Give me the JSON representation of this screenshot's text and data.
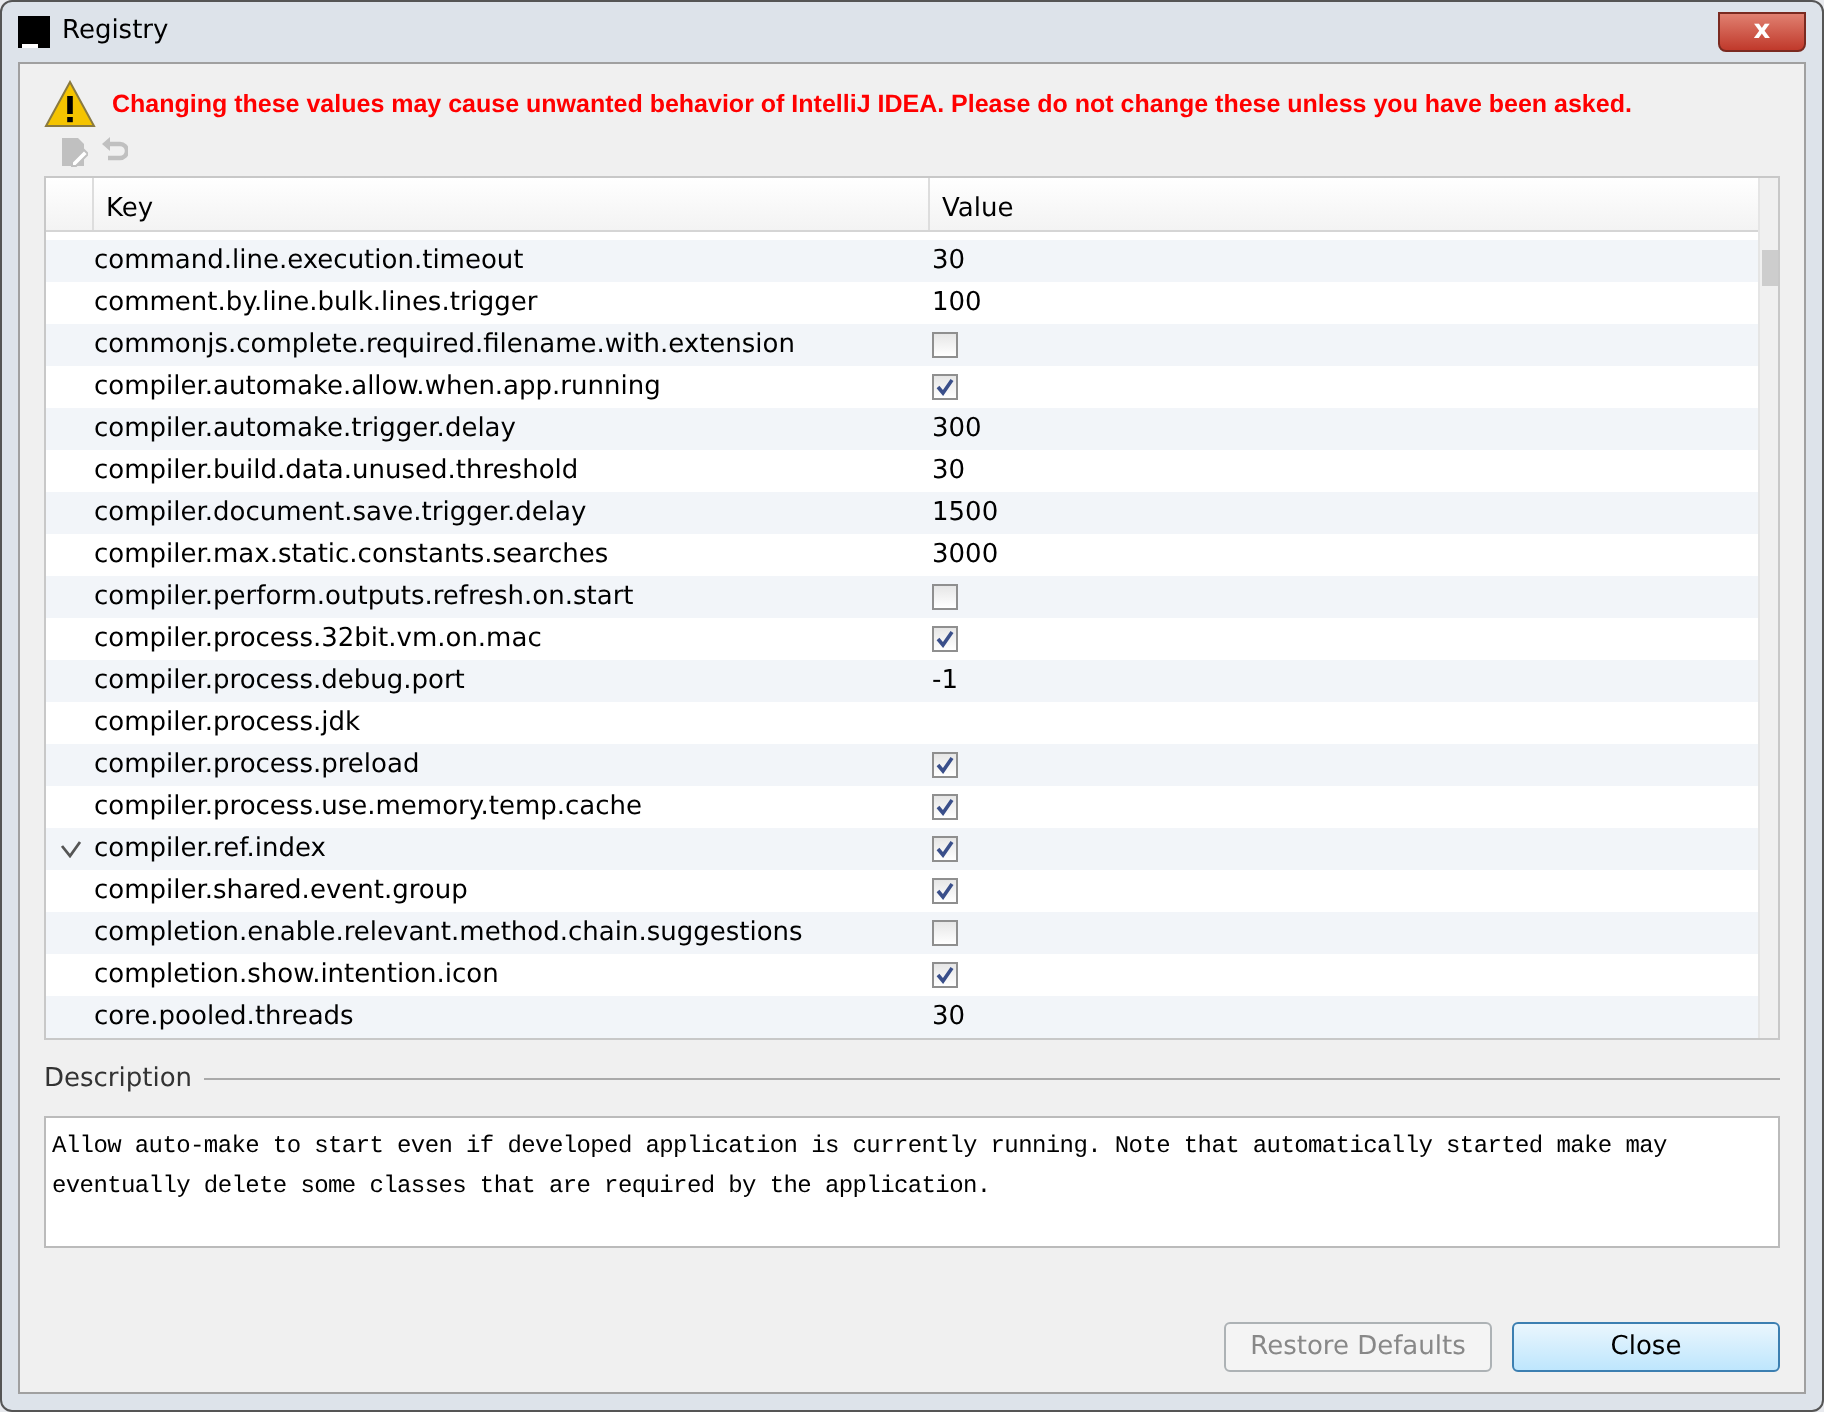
{
  "window": {
    "title": "Registry",
    "close_symbol": "x"
  },
  "warning": "Changing these values may cause unwanted behavior of IntelliJ IDEA. Please do not change these unless you have been asked.",
  "toolbar": [
    {
      "kind": "edit",
      "disabled": true
    },
    {
      "kind": "revert",
      "disabled": true
    }
  ],
  "table": {
    "columns": [
      "Key",
      "Value"
    ],
    "rows": [
      {
        "key": "command.line.execution.timeout",
        "kind": "text",
        "value": "30",
        "modified": false
      },
      {
        "key": "comment.by.line.bulk.lines.trigger",
        "kind": "text",
        "value": "100",
        "modified": false
      },
      {
        "key": "commonjs.complete.required.filename.with.extension",
        "kind": "checkbox",
        "checked": false,
        "modified": false
      },
      {
        "key": "compiler.automake.allow.when.app.running",
        "kind": "checkbox",
        "checked": true,
        "modified": false
      },
      {
        "key": "compiler.automake.trigger.delay",
        "kind": "text",
        "value": "300",
        "modified": false
      },
      {
        "key": "compiler.build.data.unused.threshold",
        "kind": "text",
        "value": "30",
        "modified": false
      },
      {
        "key": "compiler.document.save.trigger.delay",
        "kind": "text",
        "value": "1500",
        "modified": false
      },
      {
        "key": "compiler.max.static.constants.searches",
        "kind": "text",
        "value": "3000",
        "modified": false
      },
      {
        "key": "compiler.perform.outputs.refresh.on.start",
        "kind": "checkbox",
        "checked": false,
        "modified": false
      },
      {
        "key": "compiler.process.32bit.vm.on.mac",
        "kind": "checkbox",
        "checked": true,
        "modified": false
      },
      {
        "key": "compiler.process.debug.port",
        "kind": "text",
        "value": "-1",
        "modified": false
      },
      {
        "key": "compiler.process.jdk",
        "kind": "empty",
        "modified": false
      },
      {
        "key": "compiler.process.preload",
        "kind": "checkbox",
        "checked": true,
        "modified": false
      },
      {
        "key": "compiler.process.use.memory.temp.cache",
        "kind": "checkbox",
        "checked": true,
        "modified": false
      },
      {
        "key": "compiler.ref.index",
        "kind": "checkbox",
        "checked": true,
        "modified": true
      },
      {
        "key": "compiler.shared.event.group",
        "kind": "checkbox",
        "checked": true,
        "modified": false
      },
      {
        "key": "completion.enable.relevant.method.chain.suggestions",
        "kind": "checkbox",
        "checked": false,
        "modified": false
      },
      {
        "key": "completion.show.intention.icon",
        "kind": "checkbox",
        "checked": true,
        "modified": false
      },
      {
        "key": "core.pooled.threads",
        "kind": "text",
        "value": "30",
        "modified": false
      }
    ]
  },
  "description": {
    "label": "Description",
    "text": "Allow auto-make to start even if developed application is currently running. Note that automatically started make may eventually delete some classes that are required by the application."
  },
  "buttons": [
    {
      "label": "Restore Defaults",
      "disabled": true,
      "default": false
    },
    {
      "label": "Close",
      "disabled": false,
      "default": true
    }
  ]
}
